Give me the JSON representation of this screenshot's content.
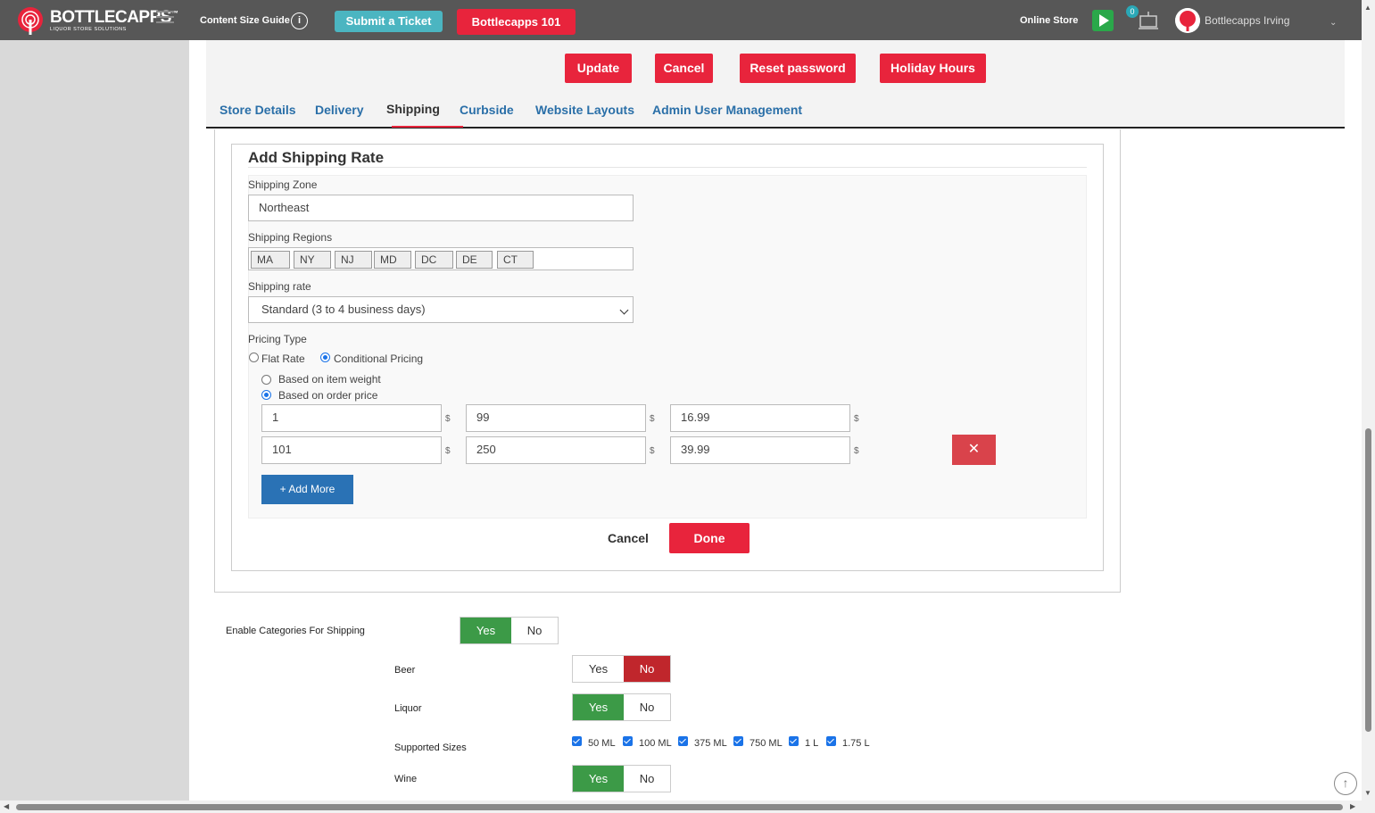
{
  "header": {
    "logo_text": "BOTTLECAPPS",
    "logo_tm": "™",
    "logo_sub": "LIQUOR STORE SOLUTIONS",
    "content_size_guide": "Content Size Guide",
    "info_icon": "i",
    "submit_ticket": "Submit a Ticket",
    "bottlecapps_101": "Bottlecapps 101",
    "online_store": "Online Store",
    "notification_count": "0",
    "user_name": "Bottlecapps Irving"
  },
  "actions": {
    "update": "Update",
    "cancel": "Cancel",
    "reset_password": "Reset password",
    "holiday_hours": "Holiday Hours"
  },
  "tabs": [
    {
      "label": "Store Details"
    },
    {
      "label": "Delivery"
    },
    {
      "label": "Shipping"
    },
    {
      "label": "Curbside"
    },
    {
      "label": "Website Layouts"
    },
    {
      "label": "Admin User Management"
    }
  ],
  "active_tab": "Shipping",
  "shipping_rate": {
    "title": "Add Shipping Rate",
    "zone_label": "Shipping Zone",
    "zone_value": "Northeast",
    "regions_label": "Shipping Regions",
    "regions": [
      "MA",
      "NY",
      "NJ",
      "MD",
      "DC",
      "DE",
      "CT"
    ],
    "rate_label": "Shipping rate",
    "rate_value": "Standard (3 to 4 business days)",
    "pricing_type_label": "Pricing Type",
    "flat_rate": "Flat Rate",
    "conditional_pricing": "Conditional Pricing",
    "based_on_weight": "Based on item weight",
    "based_on_price": "Based on order price",
    "currency": "$",
    "rows": [
      {
        "from": "1",
        "to": "99",
        "price": "16.99"
      },
      {
        "from": "101",
        "to": "250",
        "price": "39.99"
      }
    ],
    "remove_icon": "✕",
    "add_more": "+ Add More",
    "cancel": "Cancel",
    "done": "Done"
  },
  "categories": {
    "enable_label": "Enable Categories For Shipping",
    "yes": "Yes",
    "no": "No",
    "beer": "Beer",
    "liquor": "Liquor",
    "supported_sizes": "Supported Sizes",
    "sizes": [
      "50 ML",
      "100 ML",
      "375 ML",
      "750 ML",
      "1 L",
      "1.75 L"
    ],
    "wine": "Wine"
  },
  "colors": {
    "brand_red": "#e8243c",
    "link_blue": "#2a6fa8",
    "toggle_green": "#3c9a47",
    "toggle_red": "#c0262c"
  }
}
